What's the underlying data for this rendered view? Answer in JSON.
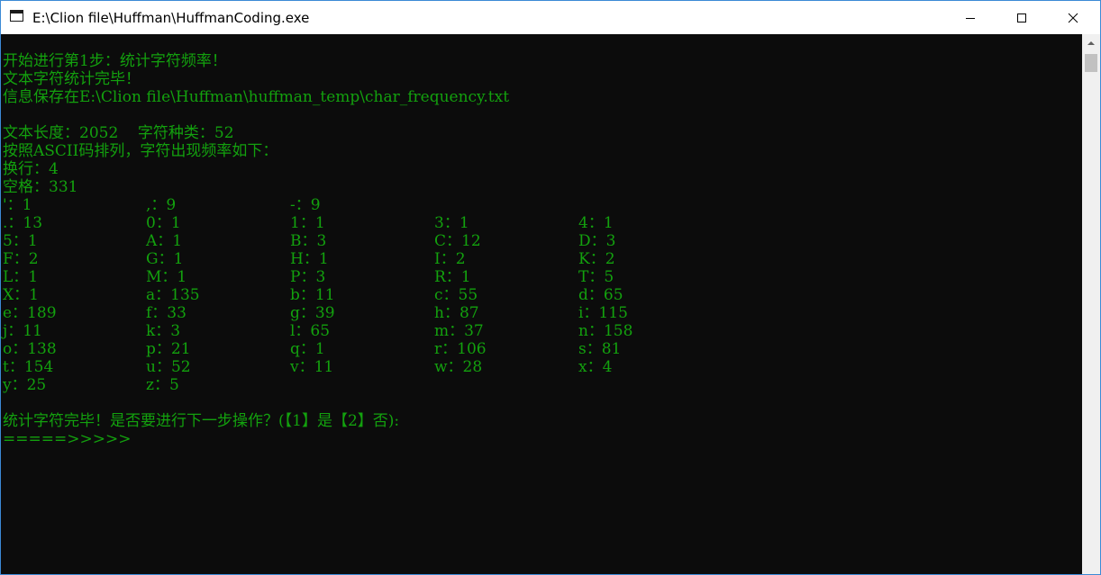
{
  "window": {
    "title": "E:\\Clion file\\Huffman\\HuffmanCoding.exe"
  },
  "console": {
    "lines": [
      "开始进行第1步：统计字符频率！",
      "文本字符统计完毕！",
      "信息保存在E:\\Clion file\\Huffman\\huffman_temp\\char_frequency.txt",
      "文本长度：2052    字符种类：52",
      "按照ASCII码排列，字符出现频率如下：",
      "换行：4",
      "空格：331"
    ],
    "frequency_rows": [
      [
        "'：1",
        ",：9",
        "-：9",
        "",
        ""
      ],
      [
        ".：13",
        "0：1",
        "1：1",
        "3：1",
        "4：1"
      ],
      [
        "5：1",
        "A：1",
        "B：3",
        "C：12",
        "D：3"
      ],
      [
        "F：2",
        "G：1",
        "H：1",
        "I：2",
        "K：2"
      ],
      [
        "L：1",
        "M：1",
        "P：3",
        "R：1",
        "T：5"
      ],
      [
        "X：1",
        "a：135",
        "b：11",
        "c：55",
        "d：65"
      ],
      [
        "e：189",
        "f：33",
        "g：39",
        "h：87",
        "i：115"
      ],
      [
        "j：11",
        "k：3",
        "l：65",
        "m：37",
        "n：158"
      ],
      [
        "o：138",
        "p：21",
        "q：1",
        "r：106",
        "s：81"
      ],
      [
        "t：154",
        "u：52",
        "v：11",
        "w：28",
        "x：4"
      ],
      [
        "y：25",
        "z：5",
        "",
        "",
        ""
      ]
    ],
    "prompt_line": "统计字符完毕！是否要进行下一步操作？(【1】是【2】否):",
    "input_prompt": "=====>>>>>"
  },
  "colors": {
    "console_bg": "#0c0c0c",
    "console_text": "#13a10e",
    "titlebar_bg": "#ffffff",
    "window_border": "#3c8ad6"
  },
  "icons": {
    "app": "console-window-icon",
    "minimize": "minimize-icon",
    "maximize": "maximize-icon",
    "close": "close-icon"
  }
}
